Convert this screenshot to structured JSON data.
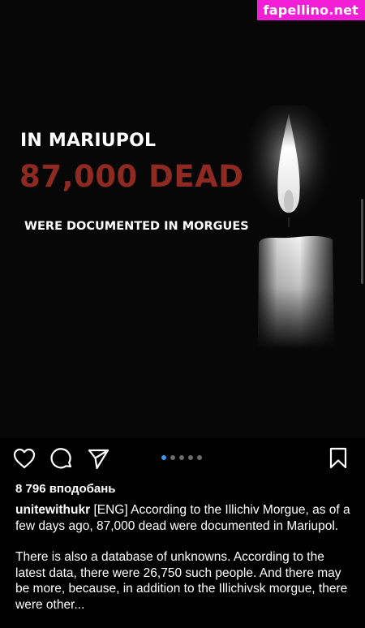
{
  "watermark": "fapellino.net",
  "post": {
    "headline": "IN MARIUPOL",
    "number": "87,000 DEAD",
    "subline": "WERE DOCUMENTED IN MORGUES"
  },
  "carousel": {
    "total": 5,
    "active_index": 0
  },
  "icons": {
    "like": "heart-icon",
    "comment": "comment-bubble-icon",
    "share": "paper-plane-icon",
    "save": "bookmark-icon"
  },
  "likes": "8 796 вподобань",
  "caption": {
    "username": "unitewithukr",
    "paragraph1": "[ENG] According to the Illichiv Morgue, as of a few days ago, 87,000 dead were documented in Mariupol.",
    "paragraph2": "There is also a database of unknowns.  According to the latest data, there were 26,750 such people.  And there may be more, because, in addition to the Illichivsk morgue, there were other..."
  },
  "colors": {
    "background": "#000000",
    "accent_red": "#8e2a22",
    "dot_active": "#3897f0",
    "watermark_bg": "#f21fd6"
  }
}
